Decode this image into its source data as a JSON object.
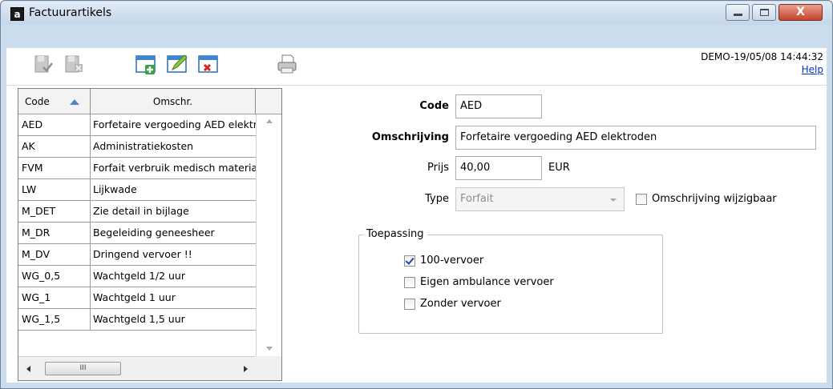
{
  "window": {
    "title": "Factuurartikels",
    "app_icon_letter": "a",
    "close_glyph": "X"
  },
  "toolbar": {
    "icons": [
      "save-icon",
      "cancel-save-icon",
      "new-record-icon",
      "edit-icon",
      "delete-icon",
      "print-icon"
    ],
    "timestamp": "DEMO-19/05/08 14:44:32",
    "help_label": "Help"
  },
  "grid": {
    "columns": [
      "Code",
      "Omschr."
    ],
    "sort_indicator": "ascending",
    "rows": [
      {
        "code": "AED",
        "omschr": "Forfetaire vergoeding AED elektroden"
      },
      {
        "code": "AK",
        "omschr": "Administratiekosten"
      },
      {
        "code": "FVM",
        "omschr": "Forfait verbruik medisch materiaal"
      },
      {
        "code": "LW",
        "omschr": "Lijkwade"
      },
      {
        "code": "M_DET",
        "omschr": "Zie detail in bijlage"
      },
      {
        "code": "M_DR",
        "omschr": "Begeleiding geneesheer"
      },
      {
        "code": "M_DV",
        "omschr": "Dringend vervoer !!"
      },
      {
        "code": "WG_0,5",
        "omschr": "Wachtgeld 1/2 uur"
      },
      {
        "code": "WG_1",
        "omschr": "Wachtgeld 1 uur"
      },
      {
        "code": "WG_1,5",
        "omschr": "Wachtgeld 1,5 uur"
      }
    ],
    "hscroll_grip": "III"
  },
  "form": {
    "code_label": "Code",
    "code_value": "AED",
    "omschrijving_label": "Omschrijving",
    "omschrijving_value": "Forfetaire vergoeding AED elektroden",
    "prijs_label": "Prijs",
    "prijs_value": "40,00",
    "currency": "EUR",
    "type_label": "Type",
    "type_value": "Forfait",
    "omschrijving_wijzigbaar_label": "Omschrijving wijzigbaar",
    "omschrijving_wijzigbaar_checked": false
  },
  "toepassing": {
    "title": "Toepassing",
    "options": [
      {
        "label": "100-vervoer",
        "checked": true
      },
      {
        "label": "Eigen ambulance vervoer",
        "checked": false
      },
      {
        "label": "Zonder vervoer",
        "checked": false
      }
    ]
  }
}
